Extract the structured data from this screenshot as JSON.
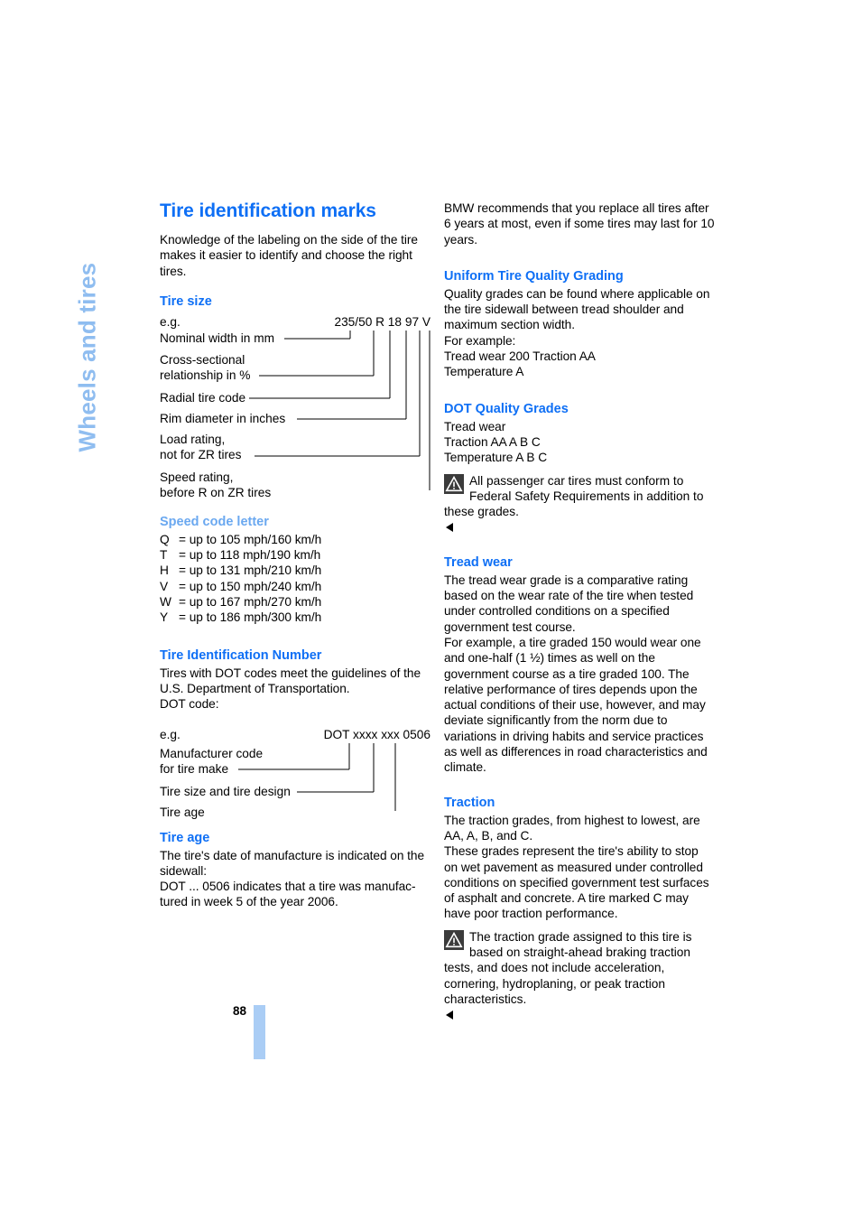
{
  "chapter": {
    "label": "Wheels and tires"
  },
  "page": {
    "number": "88"
  },
  "left": {
    "title": "Tire identification marks",
    "intro": "Knowledge of the labeling on the side of the tire makes it easier to identify and choose the right tires.",
    "tire_size": {
      "heading": "Tire size",
      "eg_label": "e.g.",
      "example_code": "235/50 R 18 97 V",
      "rows": [
        {
          "label": "Nominal width in mm"
        },
        {
          "label": "Cross-sectional\nrelationship in %"
        },
        {
          "label": "Radial tire code"
        },
        {
          "label": "Rim diameter in inches"
        },
        {
          "label": "Load rating,\nnot for ZR tires"
        },
        {
          "label": "Speed rating,\nbefore R on ZR tires"
        }
      ]
    },
    "speed_code": {
      "heading": "Speed code letter",
      "entries": [
        {
          "letter": "Q",
          "value": "= up to 105 mph/160 km/h"
        },
        {
          "letter": "T",
          "value": "= up to 118 mph/190 km/h"
        },
        {
          "letter": "H",
          "value": "= up to 131 mph/210 km/h"
        },
        {
          "letter": "V",
          "value": "= up to 150 mph/240 km/h"
        },
        {
          "letter": "W",
          "value": "= up to 167 mph/270 km/h"
        },
        {
          "letter": "Y",
          "value": "= up to 186 mph/300 km/h"
        }
      ]
    },
    "tin": {
      "heading": "Tire Identification Number",
      "body": "Tires with DOT codes meet the guidelines of the U.S. Department of Transportation.",
      "dot_label": "DOT code:",
      "eg_label": "e.g.",
      "example_code": "DOT xxxx xxx 0506",
      "rows": [
        {
          "label": "Manufacturer code\nfor tire make"
        },
        {
          "label": "Tire size and tire design"
        },
        {
          "label": "Tire age"
        }
      ]
    },
    "tire_age": {
      "heading": "Tire age",
      "body": "The tire's date of manufacture is indicated on the sidewall:",
      "body2": "DOT ... 0506 indicates that a tire was manufac-tured in week 5 of the year 2006."
    }
  },
  "right": {
    "intro": "BMW recommends that you replace all tires after 6 years at most, even if some tires may last for 10 years.",
    "utqg": {
      "heading": "Uniform Tire Quality Grading",
      "body": "Quality grades can be found where applicable on the tire sidewall between tread shoulder and maximum section width.",
      "for_example": "For example:",
      "example1": "Tread wear 200 Traction AA",
      "example2": "Temperature A"
    },
    "dot_grades": {
      "heading": "DOT Quality Grades",
      "line1": "Tread wear",
      "line2": "Traction AA A B C",
      "line3": "Temperature A B C",
      "note": "All passenger car tires must conform to Federal Safety Requirements in addition to these grades."
    },
    "tread_wear": {
      "heading": "Tread wear",
      "body1": "The tread wear grade is a comparative rating based on the wear rate of the tire when tested under controlled conditions on a specified government test course.",
      "body2": "For example, a tire graded 150 would wear one and one-half (1 ½) times as well on the government course as a tire graded 100. The relative performance of tires depends upon the actual conditions of their use, however, and may deviate significantly from the norm due to variations in driving habits and service practices as well as differences in road characteristics and climate."
    },
    "traction": {
      "heading": "Traction",
      "body1": "The traction grades, from highest to lowest, are AA, A, B, and C.",
      "body2": "These grades represent the tire's ability to stop on wet pavement as measured under controlled conditions on specified government test surfaces of asphalt and concrete. A tire marked C may have poor traction performance.",
      "note": "The traction grade assigned to this tire is based on straight-ahead braking traction tests, and does not include acceleration, cornering, hydroplaning, or peak traction characteristics."
    }
  },
  "colors": {
    "heading_blue": "#0e6ff5",
    "light_blue": "#6aa8f0",
    "tab_blue": "#8fbdf0",
    "folio_bar": "#aacdf5",
    "warn_bg": "#3b3b3b"
  }
}
